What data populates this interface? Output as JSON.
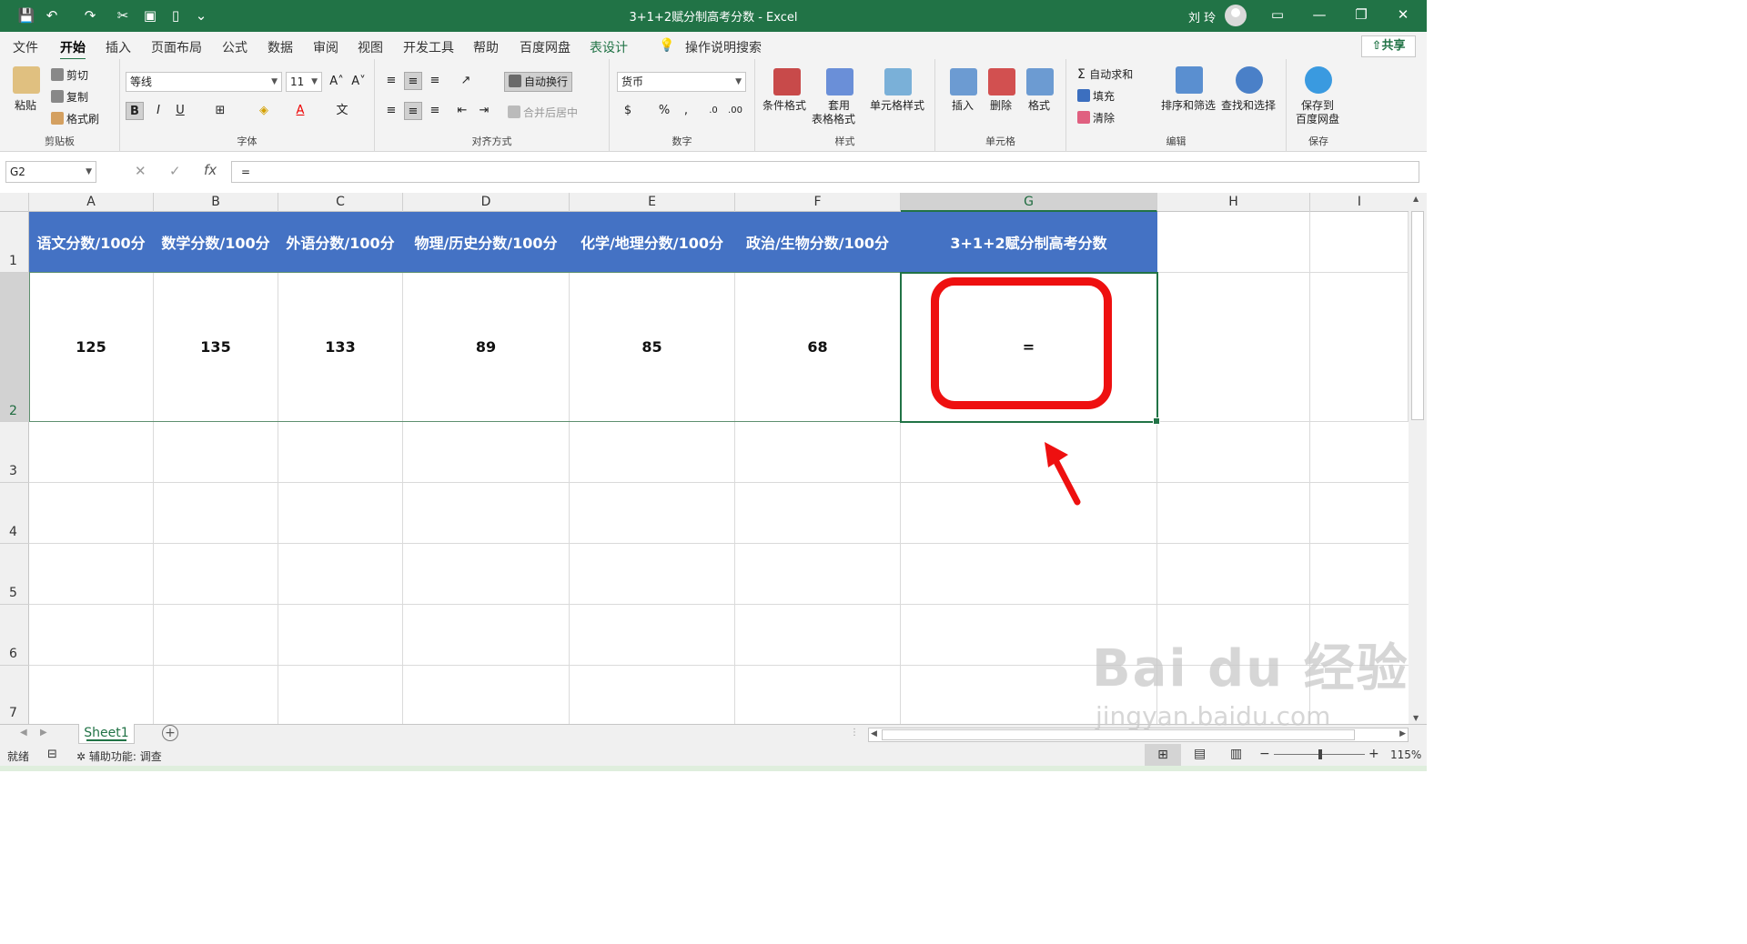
{
  "window": {
    "title": "3+1+2赋分制高考分数  -  Excel",
    "user": "刘 玲"
  },
  "menu": {
    "tabs": [
      "文件",
      "开始",
      "插入",
      "页面布局",
      "公式",
      "数据",
      "审阅",
      "视图",
      "开发工具",
      "帮助",
      "百度网盘",
      "表设计"
    ],
    "active": "开始",
    "search": "操作说明搜索",
    "share": "共享"
  },
  "ribbon": {
    "clipboard": {
      "label": "剪贴板",
      "paste": "粘贴",
      "cut": "剪切",
      "copy": "复制",
      "format_painter": "格式刷"
    },
    "font": {
      "label": "字体",
      "name": "等线",
      "size": "11"
    },
    "align": {
      "label": "对齐方式",
      "wrap": "自动换行",
      "merge": "合并后居中"
    },
    "number": {
      "label": "数字",
      "format": "货币"
    },
    "styles": {
      "label": "样式",
      "cond": "条件格式",
      "table1": "套用",
      "table2": "表格格式",
      "cell": "单元格样式"
    },
    "cells": {
      "label": "单元格",
      "insert": "插入",
      "delete": "删除",
      "format": "格式"
    },
    "edit": {
      "label": "编辑",
      "autosum": "自动求和",
      "fill": "填充",
      "clear": "清除",
      "sort": "排序和筛选",
      "find": "查找和选择"
    },
    "save": {
      "label": "保存",
      "save1": "保存到",
      "save2": "百度网盘"
    }
  },
  "formula": {
    "namebox": "G2",
    "content": "="
  },
  "columns": [
    "A",
    "B",
    "C",
    "D",
    "E",
    "F",
    "G",
    "H",
    "I"
  ],
  "rows": [
    "1",
    "2",
    "3",
    "4",
    "5",
    "6",
    "7"
  ],
  "headers": [
    "语文分数/100分",
    "数学分数/100分",
    "外语分数/100分",
    "物理/历史分数/100分",
    "化学/地理分数/100分",
    "政治/生物分数/100分",
    "3+1+2赋分制高考分数"
  ],
  "values": [
    "125",
    "135",
    "133",
    "89",
    "85",
    "68",
    "="
  ],
  "sheet": {
    "name": "Sheet1"
  },
  "status": {
    "ready": "就绪",
    "accessibility": "辅助功能: 调查",
    "zoom": "115%"
  },
  "watermark": {
    "line1": "Bai du 经验",
    "line2": "jingyan.baidu.com"
  },
  "colors": {
    "excel_green": "#217346",
    "header_blue": "#4472c4",
    "highlight_red": "#ee1010"
  }
}
